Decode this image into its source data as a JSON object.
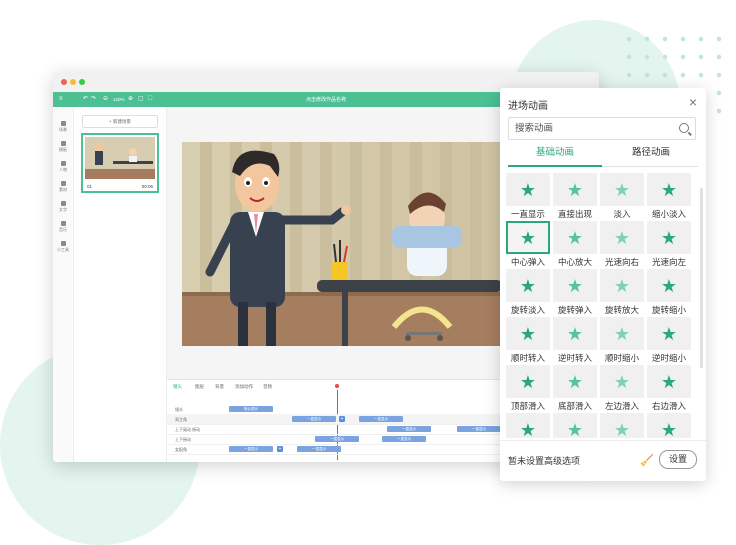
{
  "app": {
    "document_title": "点击修改作品名称",
    "zoom": "120%",
    "toolbar_icons": [
      "menu-icon",
      "undo-icon",
      "redo-icon",
      "zoom-out-icon",
      "zoom-in-icon",
      "fit-icon",
      "fullscreen-icon"
    ]
  },
  "leftnav": {
    "items": [
      {
        "label": "场景",
        "icon": "scene-icon"
      },
      {
        "label": "模板",
        "icon": "template-icon"
      },
      {
        "label": "人物",
        "icon": "character-icon"
      },
      {
        "label": "素材",
        "icon": "asset-icon"
      },
      {
        "label": "文字",
        "icon": "text-icon"
      },
      {
        "label": "音乐",
        "icon": "music-icon"
      },
      {
        "label": "小工具",
        "icon": "tools-icon"
      }
    ]
  },
  "scenes": {
    "add_label": "+ 新建场景",
    "items": [
      {
        "index": "01",
        "duration": "00:06"
      }
    ]
  },
  "timeline": {
    "tools": [
      "镜头",
      "图层",
      "背景",
      "添加动作",
      "音频"
    ],
    "rows": [
      {
        "name": "镜头",
        "bars": [
          {
            "label": "默认镜头"
          }
        ]
      },
      {
        "name": "男主角",
        "bars": [
          {
            "label": "一直显示"
          },
          {
            "label": "一直显示"
          }
        ]
      },
      {
        "name": "上下晃动 摇动",
        "bars": [
          {
            "label": "一直显示"
          },
          {
            "label": "一直显示"
          }
        ]
      },
      {
        "name": "上下摇动",
        "bars": [
          {
            "label": "一直显示"
          },
          {
            "label": "一直显示"
          }
        ]
      },
      {
        "name": "女配角",
        "bars": [
          {
            "label": "一直显示"
          },
          {
            "label": "一直显示"
          }
        ]
      }
    ]
  },
  "panel": {
    "title": "进场动画",
    "search_placeholder": "搜索动画",
    "tabs": [
      {
        "label": "基础动画",
        "active": true
      },
      {
        "label": "路径动画",
        "active": false
      }
    ],
    "effects": [
      "一直显示",
      "直接出现",
      "淡入",
      "缩小淡入",
      "中心弹入",
      "中心放大",
      "光速向右",
      "光速向左",
      "旋转淡入",
      "旋转弹入",
      "旋转放大",
      "旋转缩小",
      "顺时转入",
      "逆时转入",
      "顺时缩小",
      "逆时缩小",
      "顶部滑入",
      "底部滑入",
      "左边滑入",
      "右边滑入",
      "",
      "",
      "",
      ""
    ],
    "selected_effect": "中心弹入",
    "footer_text": "暂未设置高级选项",
    "settings_label": "设置"
  },
  "colors": {
    "accent": "#2aa876",
    "toolbar": "#4cbf93"
  }
}
